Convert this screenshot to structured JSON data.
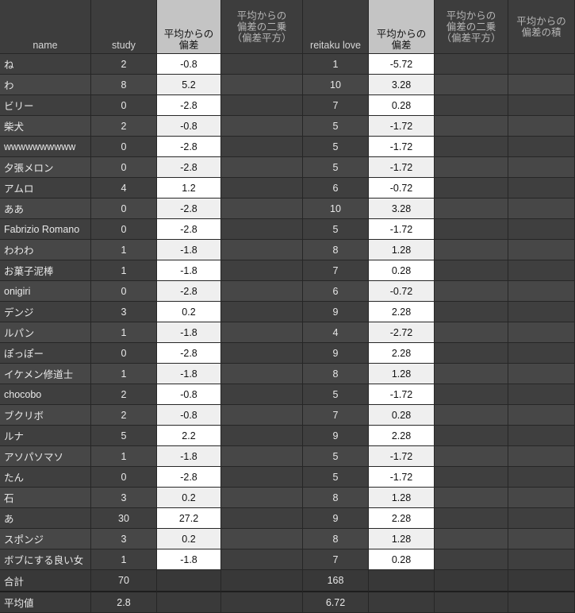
{
  "headers": {
    "name": "name",
    "study": "study",
    "dev_study": [
      "平均からの",
      "偏差"
    ],
    "sq_study": [
      "平均からの",
      "偏差の二乗",
      "（偏差平方）"
    ],
    "reitaku": "reitaku love",
    "dev_reitaku": [
      "平均からの",
      "偏差"
    ],
    "sq_reitaku": [
      "平均からの",
      "偏差の二乗",
      "（偏差平方）"
    ],
    "product": [
      "平均からの",
      "偏差の積"
    ]
  },
  "rows": [
    {
      "name": "ね",
      "study": "2",
      "dev_study": "-0.8",
      "reitaku": "1",
      "dev_reitaku": "-5.72"
    },
    {
      "name": "わ",
      "study": "8",
      "dev_study": "5.2",
      "reitaku": "10",
      "dev_reitaku": "3.28"
    },
    {
      "name": "ビリー",
      "study": "0",
      "dev_study": "-2.8",
      "reitaku": "7",
      "dev_reitaku": "0.28"
    },
    {
      "name": "柴犬",
      "study": "2",
      "dev_study": "-0.8",
      "reitaku": "5",
      "dev_reitaku": "-1.72"
    },
    {
      "name": "wwwwwwwwww",
      "study": "0",
      "dev_study": "-2.8",
      "reitaku": "5",
      "dev_reitaku": "-1.72"
    },
    {
      "name": "夕張メロン",
      "study": "0",
      "dev_study": "-2.8",
      "reitaku": "5",
      "dev_reitaku": "-1.72"
    },
    {
      "name": "アムロ",
      "study": "4",
      "dev_study": "1.2",
      "reitaku": "6",
      "dev_reitaku": "-0.72"
    },
    {
      "name": "ああ",
      "study": "0",
      "dev_study": "-2.8",
      "reitaku": "10",
      "dev_reitaku": "3.28"
    },
    {
      "name": "Fabrizio Romano",
      "study": "0",
      "dev_study": "-2.8",
      "reitaku": "5",
      "dev_reitaku": "-1.72"
    },
    {
      "name": "わわわ",
      "study": "1",
      "dev_study": "-1.8",
      "reitaku": "8",
      "dev_reitaku": "1.28"
    },
    {
      "name": "お菓子泥棒",
      "study": "1",
      "dev_study": "-1.8",
      "reitaku": "7",
      "dev_reitaku": "0.28"
    },
    {
      "name": "onigiri",
      "study": "0",
      "dev_study": "-2.8",
      "reitaku": "6",
      "dev_reitaku": "-0.72"
    },
    {
      "name": "デンジ",
      "study": "3",
      "dev_study": "0.2",
      "reitaku": "9",
      "dev_reitaku": "2.28"
    },
    {
      "name": "ルパン",
      "study": "1",
      "dev_study": "-1.8",
      "reitaku": "4",
      "dev_reitaku": "-2.72"
    },
    {
      "name": "ぽっぽー",
      "study": "0",
      "dev_study": "-2.8",
      "reitaku": "9",
      "dev_reitaku": "2.28"
    },
    {
      "name": "イケメン修道士",
      "study": "1",
      "dev_study": "-1.8",
      "reitaku": "8",
      "dev_reitaku": "1.28"
    },
    {
      "name": "chocobo",
      "study": "2",
      "dev_study": "-0.8",
      "reitaku": "5",
      "dev_reitaku": "-1.72"
    },
    {
      "name": "ブクリボ",
      "study": "2",
      "dev_study": "-0.8",
      "reitaku": "7",
      "dev_reitaku": "0.28"
    },
    {
      "name": "ルナ",
      "study": "5",
      "dev_study": "2.2",
      "reitaku": "9",
      "dev_reitaku": "2.28"
    },
    {
      "name": "アソパソマソ",
      "study": "1",
      "dev_study": "-1.8",
      "reitaku": "5",
      "dev_reitaku": "-1.72"
    },
    {
      "name": "たん",
      "study": "0",
      "dev_study": "-2.8",
      "reitaku": "5",
      "dev_reitaku": "-1.72"
    },
    {
      "name": "石",
      "study": "3",
      "dev_study": "0.2",
      "reitaku": "8",
      "dev_reitaku": "1.28"
    },
    {
      "name": "あ",
      "study": "30",
      "dev_study": "27.2",
      "reitaku": "9",
      "dev_reitaku": "2.28"
    },
    {
      "name": "スポンジ",
      "study": "3",
      "dev_study": "0.2",
      "reitaku": "8",
      "dev_reitaku": "1.28"
    },
    {
      "name": "ボブにする良い女",
      "study": "1",
      "dev_study": "-1.8",
      "reitaku": "7",
      "dev_reitaku": "0.28"
    }
  ],
  "total": {
    "label": "合計",
    "study": "70",
    "reitaku": "168"
  },
  "average": {
    "label": "平均値",
    "study": "2.8",
    "reitaku": "6.72"
  }
}
